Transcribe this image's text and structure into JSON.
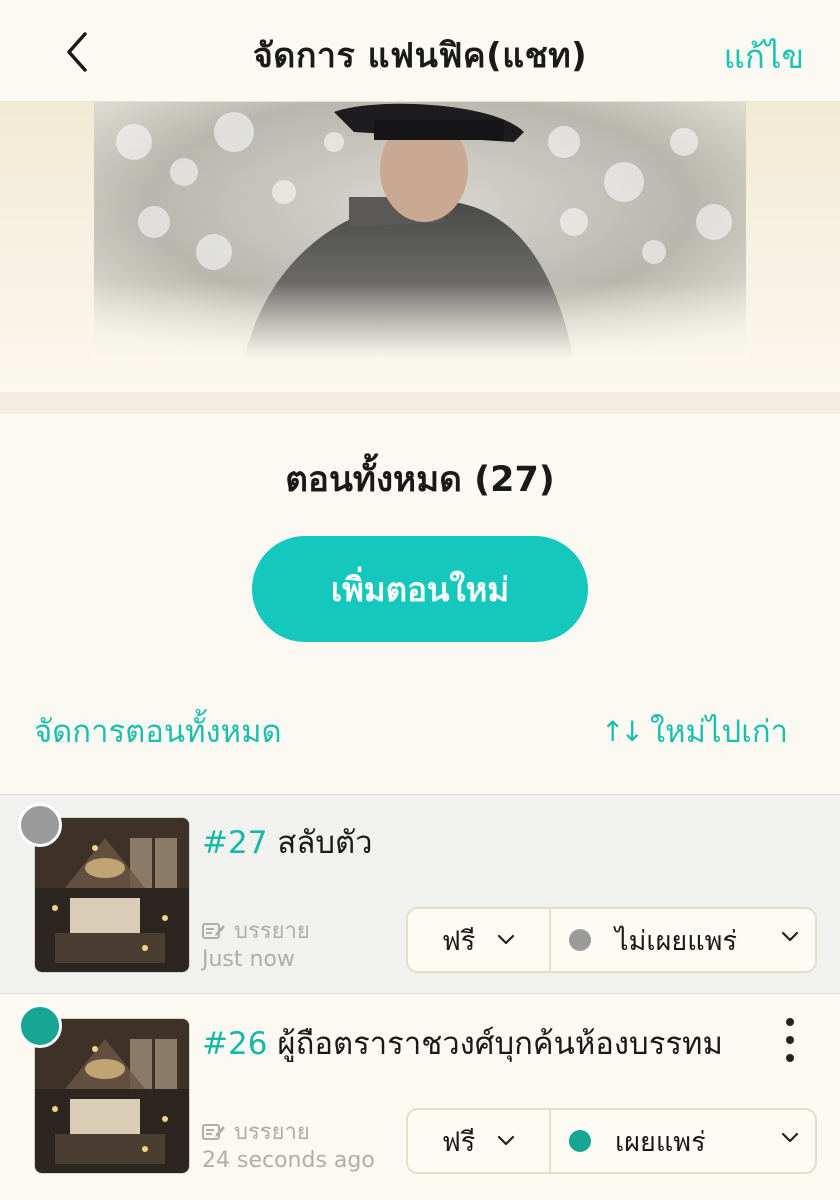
{
  "header": {
    "title": "จัดการ แฟนฟิค(แชท)",
    "edit_label": "แก้ไข"
  },
  "episodes_section": {
    "heading": "ตอนทั้งหมด (27)",
    "add_button_label": "เพิ่มตอนใหม่",
    "manage_all_label": "จัดการตอนทั้งหมด",
    "sort_label": "ใหม่ไปเก่า"
  },
  "episodes": [
    {
      "number": "#27",
      "title": "สลับตัว",
      "type_label": "บรรยาย",
      "time": "Just now",
      "price": "ฟรี",
      "publish_status": "ไม่เผยแพร่",
      "status_color": "#9b9b9b"
    },
    {
      "number": "#26",
      "title": "ผู้ถือตราราชวงศ์บุกค้นห้องบรรทม",
      "type_label": "บรรยาย",
      "time": "24 seconds ago",
      "price": "ฟรี",
      "publish_status": "เผยแพร่",
      "status_color": "#17a594"
    }
  ],
  "colors": {
    "accent": "#14c8bd",
    "link": "#1bbfb0",
    "background": "#fcf9f2"
  },
  "icons": [
    "back-arrow-icon",
    "sort-arrows-icon",
    "edit-note-icon",
    "chevron-down-icon",
    "more-vertical-icon"
  ]
}
